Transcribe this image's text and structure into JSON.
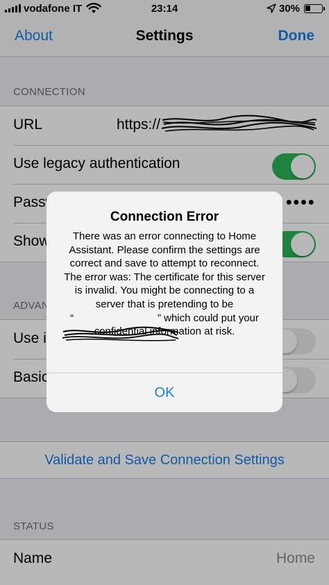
{
  "status_bar": {
    "carrier": "vodafone IT",
    "time": "23:14",
    "battery": "30%",
    "battery_level": 0.3
  },
  "nav": {
    "left": "About",
    "title": "Settings",
    "right": "Done"
  },
  "sections": {
    "connection": "CONNECTION",
    "advanced": "ADVAN",
    "status": "STATUS"
  },
  "connection": {
    "url_label": "URL",
    "url_value": "https://",
    "legacy_label": "Use legacy authentication",
    "legacy_on": true,
    "password_label": "Passw",
    "password_value": "●●●●",
    "show_label": "Show",
    "show_on": true
  },
  "advanced": {
    "row1_label": "Use i",
    "row1_on": false,
    "row2_label": "Basic",
    "row2_on": false
  },
  "validate_label": "Validate and Save Connection Settings",
  "status": {
    "name_label": "Name",
    "name_value": "Home"
  },
  "alert": {
    "title": "Connection Error",
    "message": "There was an error connecting to Home Assistant. Please confirm the settings are correct and save to attempt to reconnect. The error was: The certificate for this server is invalid. You might be connecting to a server that is pretending to be “                             ” which could put your confidential information at risk.",
    "ok": "OK"
  },
  "colors": {
    "accent": "#1a7ee8",
    "toggle_on": "#2ab657",
    "redaction": "#000000"
  }
}
